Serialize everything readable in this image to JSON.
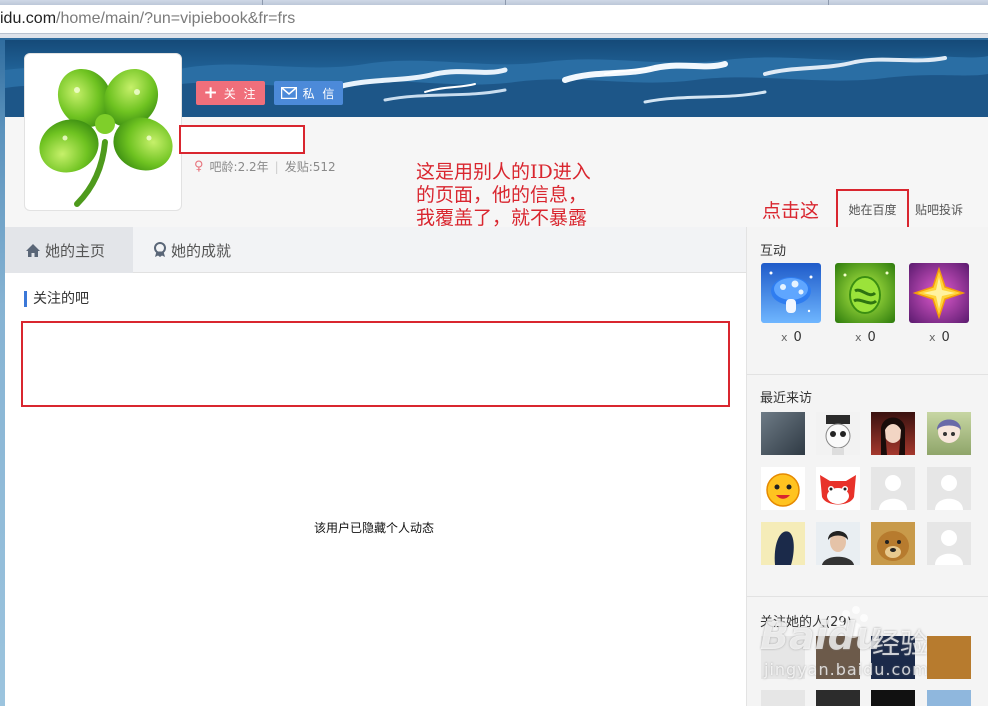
{
  "browser": {
    "url_host": "idu.com",
    "url_path": "/home/main/?un=vipiebook&fr=frs"
  },
  "profile": {
    "follow_label": "关 注",
    "message_label": "私 信",
    "bar_age": "吧龄:2.2年",
    "posts": "发贴:512",
    "gender_icon": "female-icon"
  },
  "annotations": {
    "note": "这是用别人的ID进入\n的页面，他的信息，\n我覆盖了，就不暴露\n了。",
    "click_here": "点击这"
  },
  "links": {
    "ta_baidu": "她在百度",
    "complain": "贴吧投诉"
  },
  "tabs": [
    {
      "label": "她的主页",
      "icon": "home-icon"
    },
    {
      "label": "她的成就",
      "icon": "award-icon"
    }
  ],
  "main": {
    "followed_bars_title": "关注的吧",
    "hidden_msg": "该用户已隐藏个人动态"
  },
  "sidebar": {
    "interaction_title": "互动",
    "gifts": [
      {
        "name": "mushroom-gift-icon",
        "count": "0",
        "x": "x"
      },
      {
        "name": "egg-gift-icon",
        "count": "0",
        "x": "x"
      },
      {
        "name": "star-gift-icon",
        "count": "0",
        "x": "x"
      }
    ],
    "recent_visitors_title": "最近来访",
    "followers_title": "关注她的人(29)"
  },
  "watermark": {
    "brand": "Baidu",
    "brand_cn": "经验",
    "site": "jingyan.baidu.com"
  },
  "colors": {
    "annotation_red": "#d9262f",
    "follow_pink": "#f06f7b",
    "message_blue": "#4c8ad9",
    "accent_blue": "#3b78d8"
  }
}
